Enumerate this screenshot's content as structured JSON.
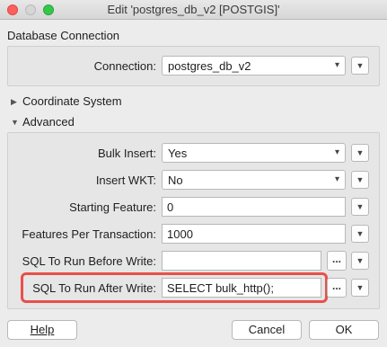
{
  "window": {
    "title": "Edit 'postgres_db_v2 [POSTGIS]'"
  },
  "sections": {
    "database_connection": "Database Connection",
    "coordinate_system": "Coordinate System",
    "advanced": "Advanced"
  },
  "connection": {
    "label": "Connection:",
    "value": "postgres_db_v2"
  },
  "advanced": {
    "bulk_insert": {
      "label": "Bulk Insert:",
      "value": "Yes"
    },
    "insert_wkt": {
      "label": "Insert WKT:",
      "value": "No"
    },
    "starting_feature": {
      "label": "Starting Feature:",
      "value": "0"
    },
    "features_per_transaction": {
      "label": "Features Per Transaction:",
      "value": "1000"
    },
    "sql_before": {
      "label": "SQL To Run Before Write:",
      "value": ""
    },
    "sql_after": {
      "label": "SQL To Run After Write:",
      "value": "SELECT bulk_http();"
    }
  },
  "buttons": {
    "dots": "...",
    "help": "Help",
    "cancel": "Cancel",
    "ok": "OK"
  },
  "colors": {
    "highlight": "#e8504a"
  },
  "icons": {
    "dropdown": "chevron-down-icon",
    "collapsed": "triangle-right-icon",
    "expanded": "triangle-down-icon"
  }
}
